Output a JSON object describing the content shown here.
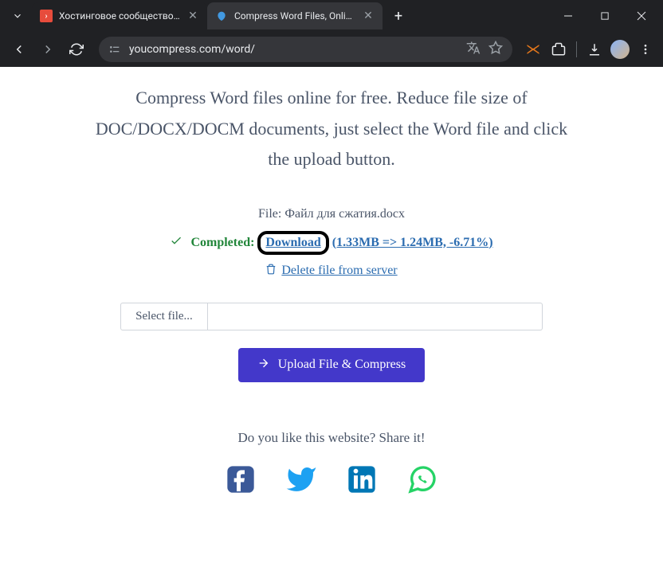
{
  "browser": {
    "tabs": [
      {
        "title": "Хостинговое сообщество «Tim",
        "active": false
      },
      {
        "title": "Compress Word Files, Online D",
        "active": true
      }
    ],
    "url": "youcompress.com/word/"
  },
  "page": {
    "hero": "Compress Word files online for free. Reduce file size of DOC/DOCX/DOCM documents, just select the Word file and click the upload button.",
    "file_label": "File: ",
    "file_name": "Файл для сжатия.docx",
    "completed_label": "Completed:",
    "download_label": "Download",
    "stats": " (1.33MB => 1.24MB, -6.71%)",
    "delete_label": " Delete file from server",
    "select_file_label": "Select file...",
    "upload_label": "Upload File & Compress",
    "share_prompt": "Do you like this website? Share it!"
  }
}
